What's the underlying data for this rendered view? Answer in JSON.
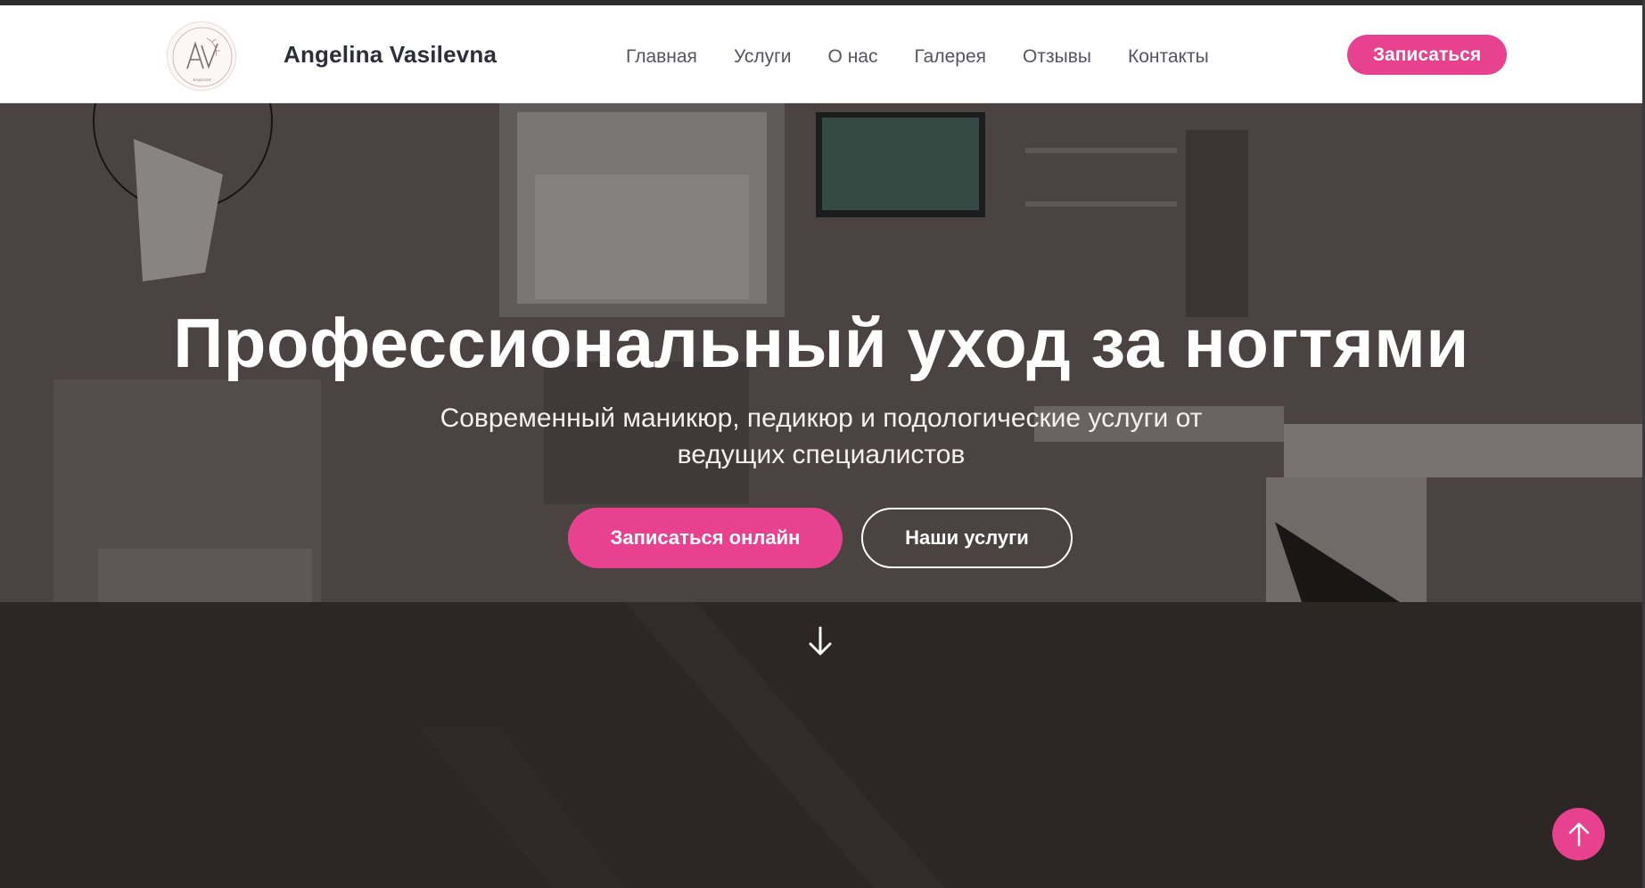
{
  "header": {
    "brand_name": "Angelina Vasilevna",
    "logo_monogram": "AV",
    "logo_caption": "подолог",
    "nav": [
      {
        "label": "Главная"
      },
      {
        "label": "Услуги"
      },
      {
        "label": "О нас"
      },
      {
        "label": "Галерея"
      },
      {
        "label": "Отзывы"
      },
      {
        "label": "Контакты"
      }
    ],
    "cta_label": "Записаться"
  },
  "hero": {
    "title": "Профессиональный уход за ногтями",
    "subtitle": "Современный маникюр, педикюр и подологические услуги от ведущих специалистов",
    "primary_button": "Записаться онлайн",
    "secondary_button": "Наши услуги",
    "scroll_icon": "arrow-down-icon"
  },
  "floating": {
    "to_top_icon": "arrow-up-icon"
  },
  "colors": {
    "accent": "#e8418f",
    "header_bg": "#ffffff",
    "brand_text": "#2e2e3a",
    "nav_text": "#555560"
  }
}
